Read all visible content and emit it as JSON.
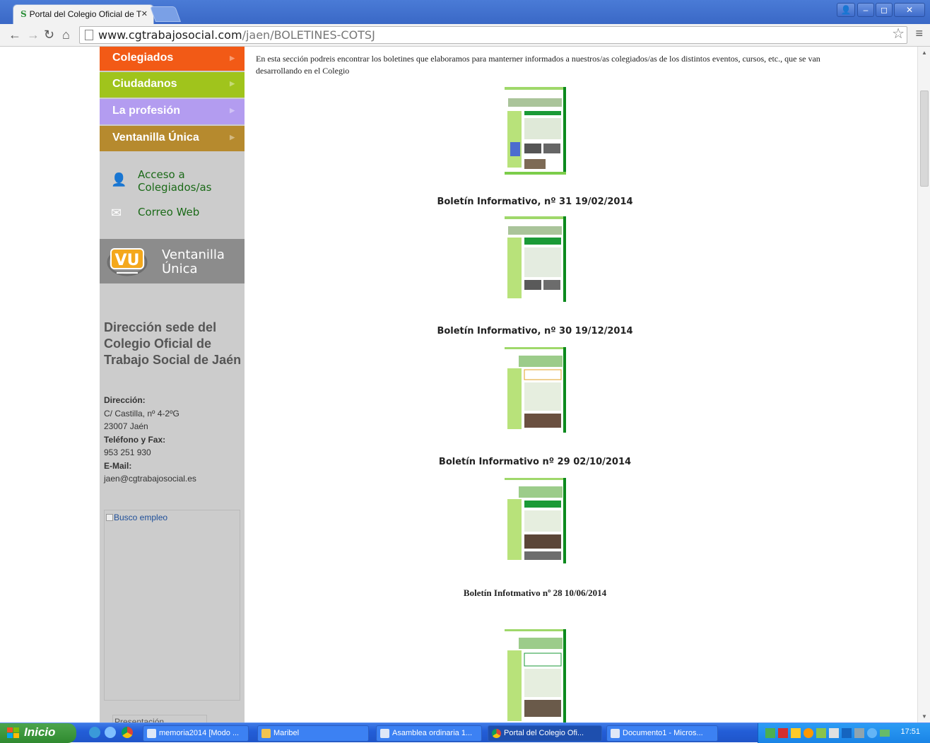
{
  "browser": {
    "tab_title": "Portal del Colegio Oficial de T",
    "url_host": "www.cgtrabajosocial.com",
    "url_path": "/jaen/BOLETINES-COTSJ"
  },
  "sidebar": {
    "nav": [
      {
        "label": "Colegiados",
        "color": "#f25a16"
      },
      {
        "label": "Ciudadanos",
        "color": "#a0c41c"
      },
      {
        "label": "La profesión",
        "color": "#b39cf0"
      },
      {
        "label": "Ventanilla Única",
        "color": "#b68a2e"
      }
    ],
    "quick_links": {
      "access": "Acceso a Colegiados/as",
      "mail": "Correo Web"
    },
    "banner": {
      "logo_text": "VU",
      "line1": "Ventanilla",
      "line2": "Única"
    },
    "address": {
      "title": "Dirección sede del Colegio Oficial de Trabajo Social de Jaén",
      "dir_label": "Dirección:",
      "dir_line1": "C/ Castilla, nº 4-2ºG",
      "dir_line2": "23007 Jaén",
      "phone_label": "Teléfono y Fax:",
      "phone": "953 251 930",
      "email_label": "E-Mail:",
      "email": "jaen@cgtrabajosocial.es"
    },
    "busco_alt": "Busco empleo",
    "presentacion_alt": "Presentación"
  },
  "main": {
    "intro": "En esta sección podreis encontrar los boletines que elaboramos para manterner informados a nuestros/as colegiados/as de los distintos eventos, cursos, etc., que se van desarrollando en el Colegio",
    "captions": [
      "Boletín Informativo, nº 31 19/02/2014",
      "Boletín Informativo, nº 30 19/12/2014",
      "Boletín Informativo nº 29 02/10/2014",
      "Boletín Infotmativo nº 28 10/06/2014"
    ]
  },
  "taskbar": {
    "start": "Inicio",
    "tasks": [
      "memoria2014 [Modo ...",
      "Maribel",
      "Asamblea ordinaria 1...",
      "Portal del Colegio Ofi...",
      "Documento1 - Micros..."
    ],
    "clock": "17:51"
  }
}
